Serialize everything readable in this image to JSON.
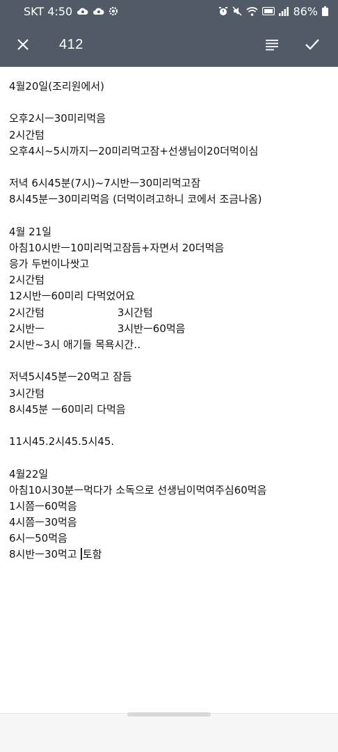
{
  "status_bar": {
    "carrier_time": "SKT 4:50",
    "battery": "86%",
    "icons": [
      "cloud-icon",
      "cloud-icon",
      "settings-icon",
      "alarm-icon",
      "mute-icon",
      "wifi-icon",
      "volte-icon",
      "signal-icon",
      "battery-icon"
    ]
  },
  "toolbar": {
    "title": "412",
    "icons": [
      "close-icon",
      "format-icon",
      "check-icon"
    ]
  },
  "note": {
    "lines": [
      "4월20일(조리원에서)",
      "",
      "오후2시ㅡ30미리먹음",
      "2시간텀",
      "오후4시~5시까지ㅡ20미리먹고잠+선생님이20더먹이심",
      "",
      "저녁 6시45분(7시)~7시반ㅡ30미리먹고잠",
      "8시45분ㅡ30미리먹음 (더먹이려고하니 코에서 조금나옴)",
      "",
      "4월 21일",
      "아침10시반ㅡ10미리먹고잠듬+자면서 20더먹음",
      "응가 두번이나쌋고",
      "2시간텀",
      "12시반ㅡ60미리 다먹었어요",
      "2시간텀                      3시간텀",
      "2시반ㅡ                      3시반ㅡ60먹음",
      "2시반~3시 애기들 목욕시간‥",
      "",
      "저녁5시45분ㅡ20먹고 잠듬",
      "3시간텀",
      "8시45분 ㅡ60미리 다먹음",
      "",
      "11시45.2시45.5시45.",
      "",
      "4월22일",
      "아침10시30분ㅡ먹다가 소독으로 선생님이먹여주심60먹음",
      "1시쯤ㅡ60먹음",
      "4시쯤ㅡ30먹음",
      "6시ㅡ50먹음"
    ],
    "last_line_before_caret": "8시반ㅡ30먹고 ",
    "last_line_after_caret": "토함"
  }
}
